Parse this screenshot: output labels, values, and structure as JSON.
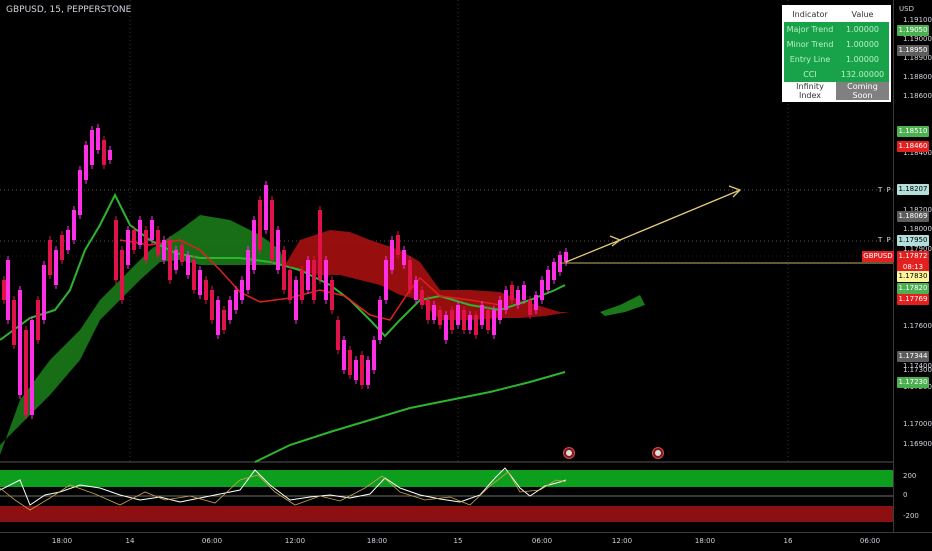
{
  "symbol": {
    "title": "GBPUSD, 15, PEPPERSTONE"
  },
  "price_axis": {
    "unit": "USD",
    "ticks": [
      "1.19100",
      "1.19000",
      "1.18900",
      "1.18800",
      "1.18600",
      "1.18400",
      "1.18200",
      "1.18000",
      "1.17900",
      "1.17600",
      "1.17400",
      "1.17300",
      "1.17200",
      "1.17000",
      "1.16900"
    ],
    "tags": [
      {
        "label": "1.19050",
        "bg": "#4caf50",
        "fg": "#ffffff"
      },
      {
        "label": "1.18950",
        "bg": "#5d5d5d",
        "fg": "#ffffff"
      },
      {
        "label": "1.18510",
        "bg": "#4caf50",
        "fg": "#ffffff"
      },
      {
        "label": "1.18460",
        "bg": "#e41f1f",
        "fg": "#ffffff"
      },
      {
        "label": "1.18207",
        "bg": "#b2dfdb",
        "fg": "#000000"
      },
      {
        "label": "1.18069",
        "bg": "#5d5d5d",
        "fg": "#ffffff"
      },
      {
        "label": "1.17950",
        "bg": "#b2dfdb",
        "fg": "#000000"
      },
      {
        "label": "1.17872",
        "bg": "#e41f1f",
        "fg": "#ffffff"
      },
      {
        "label": "08:13",
        "bg": "#e41f1f",
        "fg": "#ffffff"
      },
      {
        "label": "1.17830",
        "bg": "#fff59d",
        "fg": "#000000"
      },
      {
        "label": "1.17820",
        "bg": "#4caf50",
        "fg": "#ffffff"
      },
      {
        "label": "1.17769",
        "bg": "#e41f1f",
        "fg": "#ffffff"
      },
      {
        "label": "1.17344",
        "bg": "#5d5d5d",
        "fg": "#ffffff"
      },
      {
        "label": "1.17230",
        "bg": "#4caf50",
        "fg": "#ffffff"
      }
    ],
    "symbol_tag": "GBPUSD"
  },
  "tp_labels": [
    "T P",
    "T P"
  ],
  "oscillator": {
    "ticks": [
      "200",
      "0",
      "-200"
    ],
    "upper_band": "#0e9e1e",
    "lower_band": "#8c0f12"
  },
  "time_axis": [
    "18:00",
    "14",
    "06:00",
    "12:00",
    "18:00",
    "15",
    "06:00",
    "12:00",
    "18:00",
    "16",
    "06:00"
  ],
  "indicator_table": {
    "header": [
      "Indicator",
      "Value"
    ],
    "rows": [
      [
        "Major Trend",
        "1.00000"
      ],
      [
        "Minor Trend",
        "1.00000"
      ],
      [
        "Entry Line",
        "1.00000"
      ],
      [
        "CCI",
        "132.00000"
      ]
    ],
    "footer": [
      "Infinity Index",
      "Coming Soon"
    ]
  },
  "colors": {
    "bull": "#ff2fe6",
    "bear": "#e0124a",
    "cloud_green": "#1a7a1a",
    "cloud_red": "#b01010",
    "trend_fast": "#2db52d",
    "trend_slow": "#e02020",
    "arrow": "#e3c879"
  }
}
